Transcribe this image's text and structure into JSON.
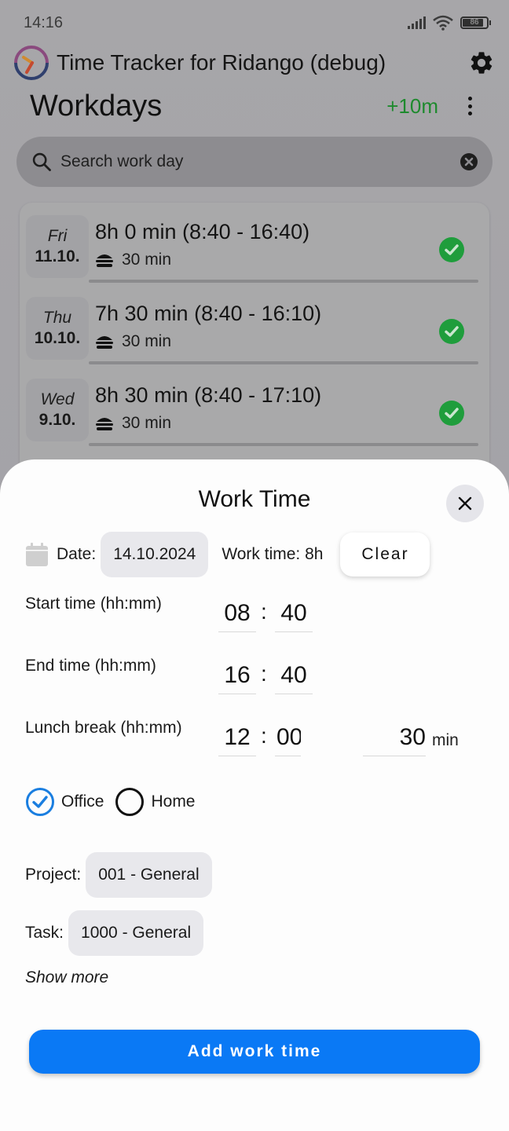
{
  "status_bar": {
    "time": "14:16",
    "battery": "86",
    "wifi_label": "6"
  },
  "app_bar": {
    "title": "Time Tracker for Ridango (debug)",
    "logo_icon": "clock-logo-icon",
    "settings_icon": "gear-icon"
  },
  "page": {
    "title": "Workdays",
    "balance": "+10m",
    "balance_color": "#1e8a2e",
    "menu_icon": "more-vert-icon"
  },
  "search": {
    "placeholder": "Search work day",
    "value": ""
  },
  "workdays": [
    {
      "day": "Fri",
      "date": "11.10.",
      "summary": "8h 0 min (8:40 - 16:40)",
      "lunch": "30 min",
      "status": "complete"
    },
    {
      "day": "Thu",
      "date": "10.10.",
      "summary": "7h 30 min (8:40 - 16:10)",
      "lunch": "30 min",
      "status": "complete"
    },
    {
      "day": "Wed",
      "date": "9.10.",
      "summary": "8h 30 min (8:40 - 17:10)",
      "lunch": "30 min",
      "status": "complete"
    }
  ],
  "sheet": {
    "title": "Work Time",
    "date_label": "Date:",
    "date_value": "14.10.2024",
    "work_time": "Work time: 8h",
    "clear_label": "Clear",
    "start": {
      "label": "Start time (hh:mm)",
      "hh": "08",
      "mm": "40"
    },
    "end": {
      "label": "End time (hh:mm)",
      "hh": "16",
      "mm": "40"
    },
    "lunch": {
      "label": "Lunch break (hh:mm)",
      "hh": "12",
      "mm": "00",
      "duration": "30",
      "unit": "min"
    },
    "colon": ":",
    "location": {
      "options": [
        {
          "label": "Office",
          "selected": true
        },
        {
          "label": "Home",
          "selected": false
        }
      ]
    },
    "project_label": "Project:",
    "project_value": "001 - General",
    "task_label": "Task:",
    "task_value": "1000 - General",
    "show_more": "Show more",
    "submit_label": "Add work time",
    "accent_color": "#0a79f5"
  }
}
